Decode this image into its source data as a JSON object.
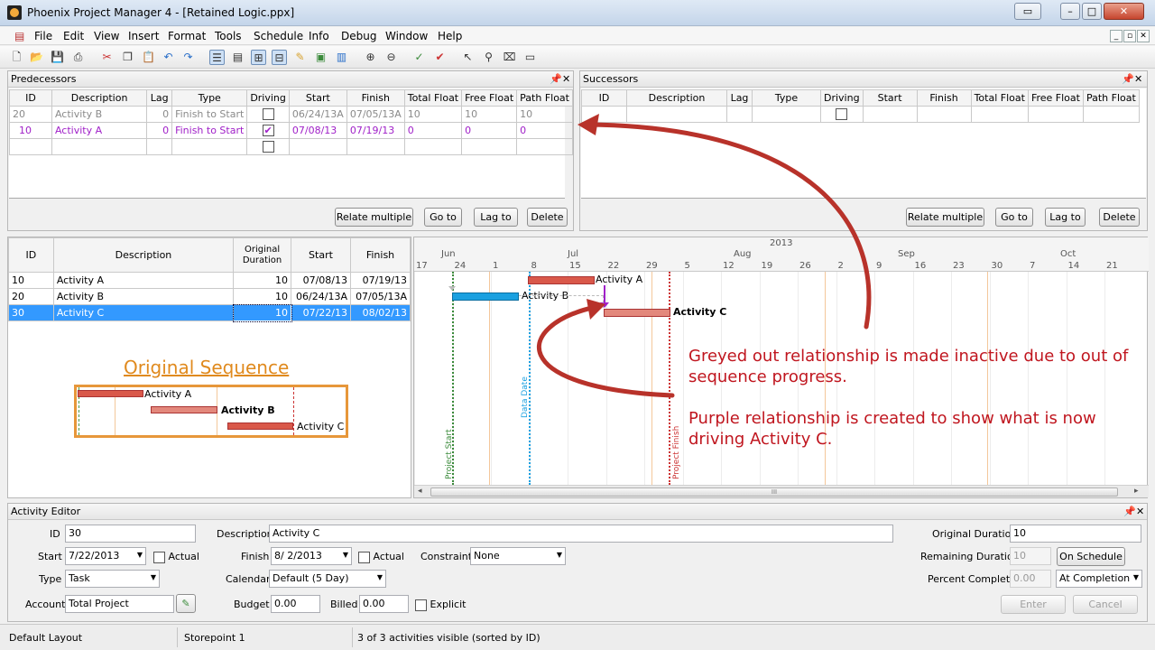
{
  "window": {
    "title": "Phoenix Project Manager 4 - [Retained Logic.ppx]"
  },
  "menu": [
    "File",
    "Edit",
    "View",
    "Insert",
    "Format",
    "Tools",
    "Schedule",
    "Info",
    "Debug",
    "Window",
    "Help"
  ],
  "predecessors": {
    "title": "Predecessors",
    "columns": [
      "ID",
      "Description",
      "Lag",
      "Type",
      "Driving",
      "Start",
      "Finish",
      "Total Float",
      "Free Float",
      "Path Float"
    ],
    "rows": [
      {
        "id": "20",
        "desc": "Activity B",
        "lag": "0",
        "type": "Finish to Start",
        "driving": false,
        "start": "06/24/13A",
        "finish": "07/05/13A",
        "tf": "10",
        "ff": "10",
        "pf": "10"
      },
      {
        "id": "10",
        "desc": "Activity A",
        "lag": "0",
        "type": "Finish to Start",
        "driving": true,
        "start": "07/08/13",
        "finish": "07/19/13",
        "tf": "0",
        "ff": "0",
        "pf": "0"
      }
    ],
    "buttons": [
      "Relate multiple",
      "Go to",
      "Lag to",
      "Delete"
    ]
  },
  "successors": {
    "title": "Successors",
    "columns": [
      "ID",
      "Description",
      "Lag",
      "Type",
      "Driving",
      "Start",
      "Finish",
      "Total Float",
      "Free Float",
      "Path Float"
    ],
    "buttons": [
      "Relate multiple",
      "Go to",
      "Lag to",
      "Delete"
    ]
  },
  "activities": {
    "columns": [
      "ID",
      "Description",
      "Original Duration",
      "Start",
      "Finish"
    ],
    "rows": [
      {
        "id": "10",
        "desc": "Activity A",
        "dur": "10",
        "start": "07/08/13",
        "finish": "07/19/13"
      },
      {
        "id": "20",
        "desc": "Activity B",
        "dur": "10",
        "start": "06/24/13A",
        "finish": "07/05/13A"
      },
      {
        "id": "30",
        "desc": "Activity C",
        "dur": "10",
        "start": "07/22/13",
        "finish": "08/02/13"
      }
    ]
  },
  "original_sequence": {
    "title": "Original Sequence",
    "labels": [
      "Activity A",
      "Activity B",
      "Activity C"
    ]
  },
  "gantt": {
    "year": "2013",
    "months": [
      "Jun",
      "Jul",
      "Aug",
      "Sep",
      "Oct"
    ],
    "days": [
      "17",
      "24",
      "1",
      "8",
      "15",
      "22",
      "29",
      "5",
      "12",
      "19",
      "26",
      "2",
      "9",
      "16",
      "23",
      "30",
      "7",
      "14",
      "21"
    ],
    "bar_labels": [
      "Activity A",
      "Activity B",
      "Activity C"
    ],
    "lines": {
      "project_start": "Project Start",
      "data_date": "Data Date",
      "project_finish": "Project Finish"
    }
  },
  "annotations": {
    "greyed": "Greyed out relationship is made inactive due to out of sequence progress.",
    "purple": "Purple relationship is created to show what is now driving Activity C."
  },
  "editor": {
    "title": "Activity Editor",
    "id_label": "ID",
    "id": "30",
    "desc_label": "Description",
    "desc": "Activity C",
    "orig_dur_label": "Original Duration",
    "orig_dur": "10",
    "start_label": "Start",
    "start": "7/22/2013",
    "actual_label": "Actual",
    "finish_label": "Finish",
    "finish": "8/ 2/2013",
    "constraint_label": "Constraint",
    "constraint": "None",
    "rem_dur_label": "Remaining Duration",
    "rem_dur": "10",
    "on_schedule": "On Schedule",
    "type_label": "Type",
    "type": "Task",
    "calendar_label": "Calendar",
    "calendar": "Default (5 Day)",
    "pct_label": "Percent Complete",
    "pct": "0.00",
    "at_completion": "At Completion",
    "account_label": "Account",
    "account": "Total Project",
    "budget_label": "Budget",
    "budget": "0.00",
    "billed_label": "Billed",
    "billed": "0.00",
    "explicit_label": "Explicit",
    "enter": "Enter",
    "cancel": "Cancel"
  },
  "status": {
    "layout": "Default Layout",
    "storepoint": "Storepoint 1",
    "visible": "3 of 3 activities visible (sorted by ID)"
  }
}
